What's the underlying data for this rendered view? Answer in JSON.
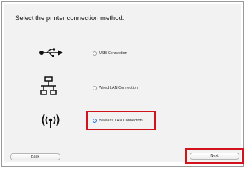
{
  "dialog": {
    "title": "Select the printer connection method."
  },
  "options": [
    {
      "label": "USB Connection",
      "icon": "usb-icon",
      "selected": false
    },
    {
      "label": "Wired LAN Connection",
      "icon": "wired-network-icon",
      "selected": false
    },
    {
      "label": "Wireless LAN Connection",
      "icon": "wireless-icon",
      "selected": true
    }
  ],
  "buttons": {
    "back_label": "Back",
    "next_label": "Next"
  },
  "colors": {
    "highlight": "#d1141b",
    "radio_selected": "#2f86e8"
  }
}
